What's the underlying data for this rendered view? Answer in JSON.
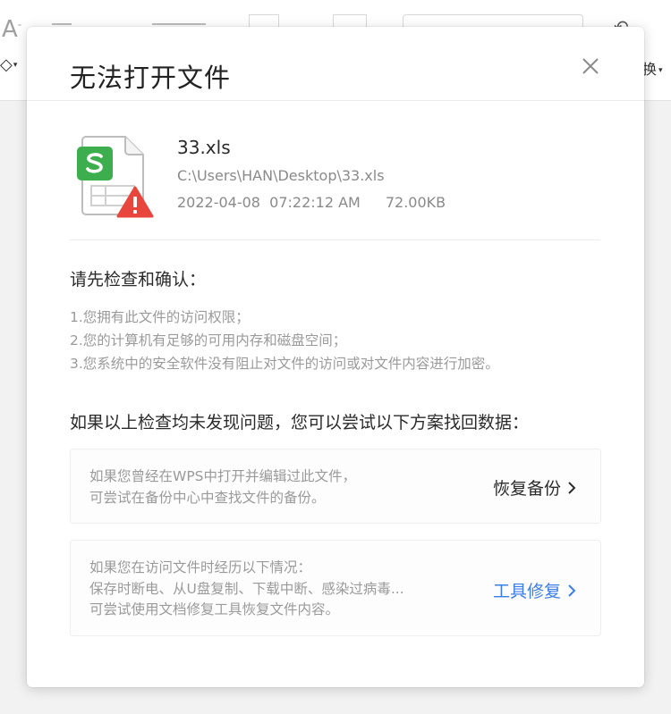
{
  "toolbar": {
    "font_size_glyph": "A",
    "font_size_suffix": "-",
    "right_text": "换"
  },
  "dialog": {
    "title": "无法打开文件",
    "file": {
      "name": "33.xls",
      "path": "C:\\Users\\HAN\\Desktop\\33.xls",
      "datetime": "2022-04-08  07:22:12 AM",
      "size": "72.00KB"
    },
    "check": {
      "heading": "请先检查和确认：",
      "items": [
        "1.您拥有此文件的访问权限；",
        "2.您的计算机有足够的可用内存和磁盘空间；",
        "3.您系统中的安全软件没有阻止对文件的访问或对文件内容进行加密。"
      ]
    },
    "recover_heading": "如果以上检查均未发现问题，您可以尝试以下方案找回数据：",
    "options": {
      "backup": {
        "lines": [
          "如果您曾经在WPS中打开并编辑过此文件，",
          "可尝试在备份中心中查找文件的备份。"
        ],
        "action": "恢复备份"
      },
      "repair": {
        "lines": [
          "如果您在访问文件时经历以下情况：",
          "保存时断电、从U盘复制、下载中断、感染过病毒...",
          "可尝试使用文档修复工具恢复文件内容。"
        ],
        "action": "工具修复"
      }
    }
  },
  "colors": {
    "accent": "#3b7ee6",
    "spreadsheet_green": "#3dae4e",
    "warning_red": "#e8453c"
  },
  "icons": [
    "spreadsheet-file-icon",
    "warning-icon",
    "close-icon",
    "chevron-right-icon"
  ]
}
